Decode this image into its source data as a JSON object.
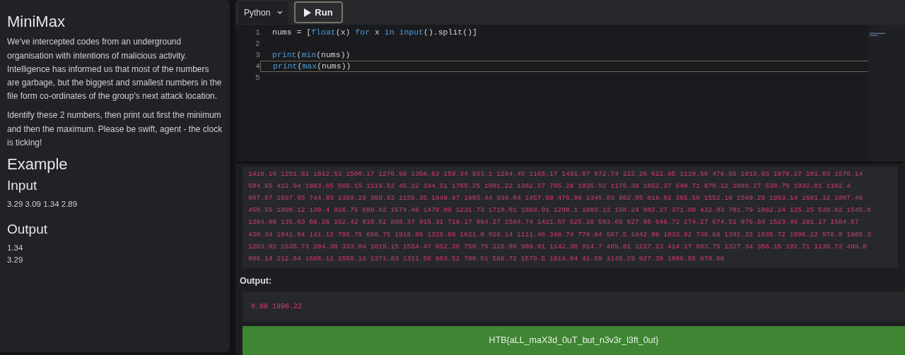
{
  "problem": {
    "title": "MiniMax",
    "paragraphs": [
      "We've intercepted codes from an underground organisation with intentions of malicious activity. Intelligence has informed us that most of the numbers are garbage, but the biggest and smallest numbers in the file form co-ordinates of the group's next attack location.",
      "Identify these 2 numbers, then print out first the minimum and then the maximum. Please be swift, agent - the clock is ticking!"
    ],
    "example_heading": "Example",
    "input_heading": "Input",
    "input_text": "3.29 3.09 1.34 2.89",
    "output_heading": "Output",
    "output_lines": [
      "1.34",
      "3.29"
    ]
  },
  "editor": {
    "language": "Python",
    "run_label": "Run",
    "lines": [
      {
        "number": "1",
        "active": false,
        "tokens": [
          {
            "kind": "plain",
            "text": "nums = ["
          },
          {
            "kind": "builtin",
            "text": "float"
          },
          {
            "kind": "plain",
            "text": "(x) "
          },
          {
            "kind": "keyword",
            "text": "for"
          },
          {
            "kind": "plain",
            "text": " x "
          },
          {
            "kind": "keyword",
            "text": "in "
          },
          {
            "kind": "builtin",
            "text": "input"
          },
          {
            "kind": "plain",
            "text": "().split()]"
          }
        ]
      },
      {
        "number": "2",
        "active": false
      },
      {
        "number": "3",
        "active": false,
        "tokens": [
          {
            "kind": "builtin",
            "text": "print"
          },
          {
            "kind": "plain",
            "text": "("
          },
          {
            "kind": "builtin",
            "text": "min"
          },
          {
            "kind": "plain",
            "text": "(nums))"
          }
        ]
      },
      {
        "number": "4",
        "active": true,
        "tokens": [
          {
            "kind": "builtin",
            "text": "print"
          },
          {
            "kind": "plain",
            "text": "("
          },
          {
            "kind": "builtin",
            "text": "max"
          },
          {
            "kind": "plain",
            "text": "(nums))"
          }
        ]
      },
      {
        "number": "5",
        "active": false
      }
    ]
  },
  "input_lines": [
    "1416.16 1251.81 1012.53 1500.17 1276.98 1358.63 159.34 933.1 1284.45 1165.17 1491.87 672.74 222.26 622.95 1110.56 476.56 1018.83 1978.27 101.03 1576.14",
    "504.65 412.94 1883.65 565.15 1119.52 45.22 344.51 1765.25 1001.22 1362.57 785.28 1035.92 1176.38 1052.37 640.71 870.12 1089.27 530.75 1932.01 1192.4",
    "607.57 1667.05 744.03 1359.29 388.53 1155.35 1849.97 1603.44 939.04 1457.88 476.98 1345.03 982.05 818.02 365.56 1552.18 1560.29 1953.14 1681.32 1007.48",
    "456.55 1890.12 139.4 816.75 699.82 1574.48 1479.99 1231.73 1710.01 1883.91 1298.1 1083.12 158.24 902.27 371.08 432.03 701.79 1062.24 125.25 539.82 1545.8",
    "1384.08 135.03 66.26 152.42 810.52 888.37 915.31 719.17 964.27 1584.74 1421.67 525.26 503.08 827.96 646.72 274.27 674.51 976.84 1523.46 281.17 1584.57",
    "430.34 1941.04 141.12 706.75 698.75 1918.86 1326.69 1621.0 926.14 1111.48 348.74 778.64 567.5 1842.08 1033.92 738.68 1391.33 1035.72 1996.22 978.0 1905.3",
    "1283.02 1535.73 204.38 333.04 1819.15 1554.47 652.36 750.76 225.09 909.01 1142.38 914.7 485.01 1227.23 414.17 603.75 1327.34 356.15 192.71 1136.72 496.0",
    "996.14 212.64 1686.11 1558.18 1371.83 1311.56 883.52 700.51 586.72 1579.5 1814.84 41.69 1145.29 927.39 1098.55 870.66"
  ],
  "output_label": "Output:",
  "output_text": "0.08 1996.22",
  "flag": "HTB{aLL_maX3d_0uT_but_n3v3r_l3ft_0ut}"
}
